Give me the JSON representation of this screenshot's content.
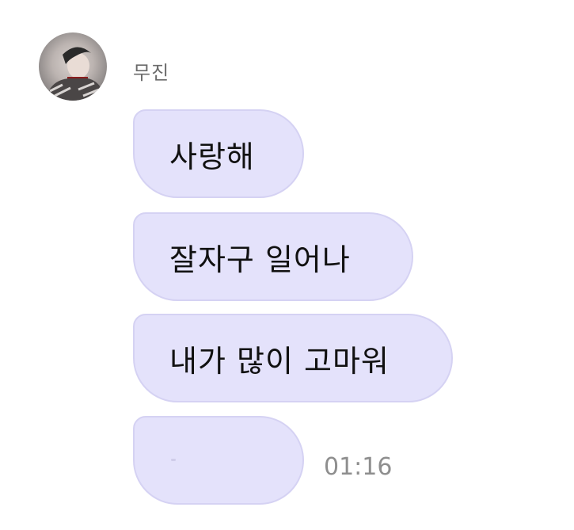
{
  "chat": {
    "sender": {
      "name": "무진",
      "avatar_icon": "profile-photo"
    },
    "messages": [
      {
        "text": "사랑해"
      },
      {
        "text": "잘자구 일어나"
      },
      {
        "text": "내가 많이 고마워"
      },
      {
        "text": "",
        "time": "01:16"
      }
    ]
  },
  "colors": {
    "bubble": "#e4e2fb",
    "bubble_border": "#d5d2f3",
    "sender_name": "#6b6b6b",
    "timestamp": "#8e8e8e",
    "message_text": "#111111"
  }
}
